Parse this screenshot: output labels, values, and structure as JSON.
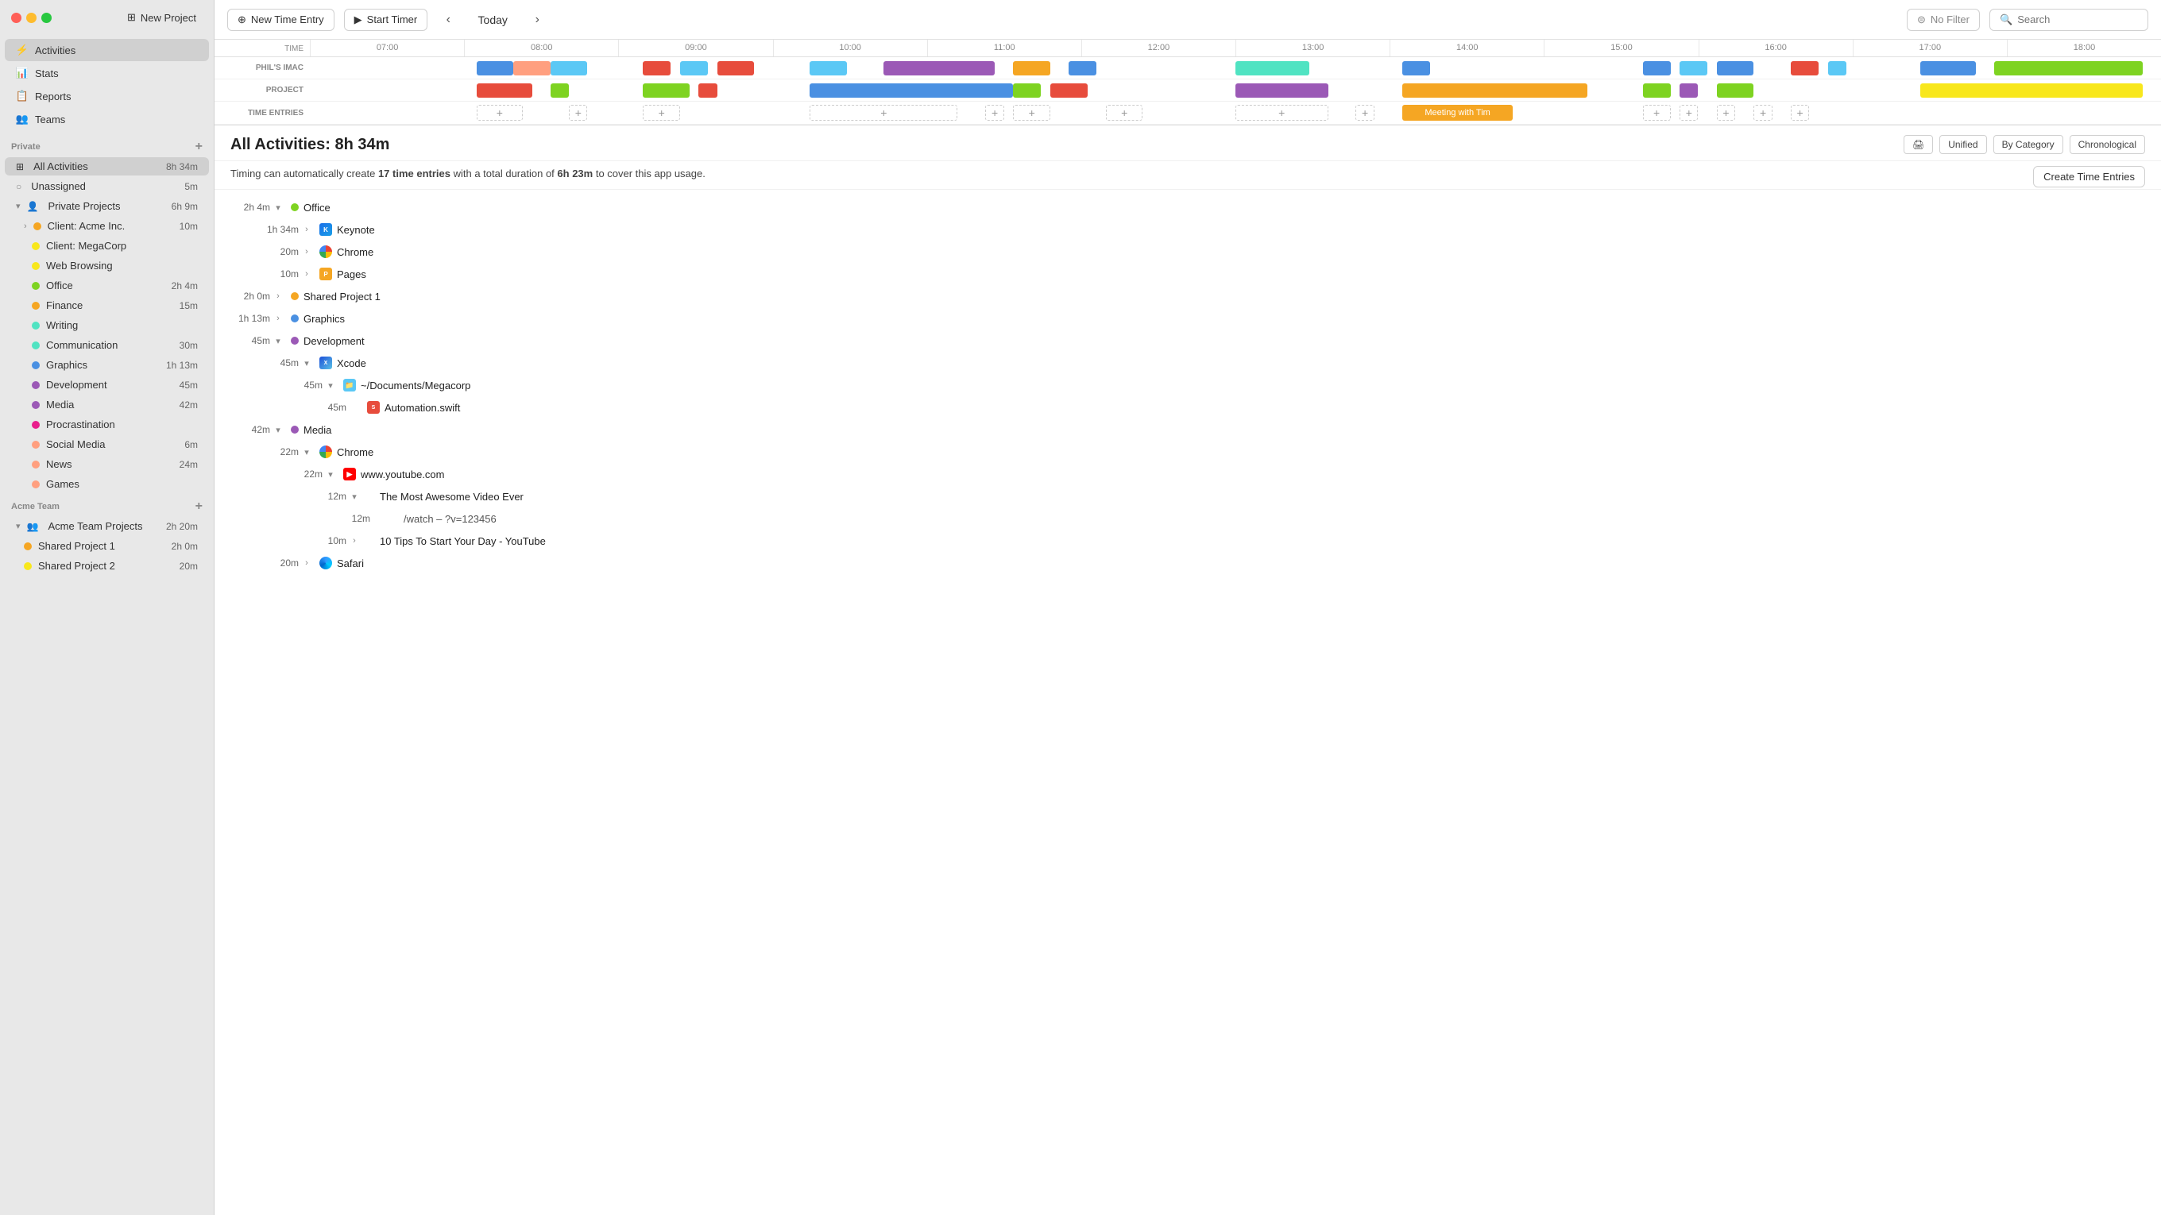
{
  "sidebar": {
    "new_project_label": "New Project",
    "nav": [
      {
        "id": "activities",
        "label": "Activities",
        "icon": "⚡",
        "active": true
      },
      {
        "id": "stats",
        "label": "Stats",
        "icon": "📊"
      },
      {
        "id": "reports",
        "label": "Reports",
        "icon": "📋"
      },
      {
        "id": "teams",
        "label": "Teams",
        "icon": "👥"
      }
    ],
    "private_section": "Private",
    "all_activities": {
      "label": "All Activities",
      "duration": "8h 34m"
    },
    "unassigned": {
      "label": "Unassigned",
      "duration": "5m"
    },
    "private_projects": {
      "label": "Private Projects",
      "duration": "6h 9m"
    },
    "clients": [
      {
        "label": "Client: Acme Inc.",
        "duration": "10m",
        "color": "dot-orange"
      },
      {
        "label": "Client: MegaCorp",
        "duration": "",
        "color": "dot-yellow"
      },
      {
        "label": "Web Browsing",
        "duration": "",
        "color": "dot-yellow"
      },
      {
        "label": "Office",
        "duration": "2h 4m",
        "color": "dot-lime"
      },
      {
        "label": "Finance",
        "duration": "15m",
        "color": "dot-orange"
      },
      {
        "label": "Writing",
        "duration": "",
        "color": "dot-cyan"
      },
      {
        "label": "Communication",
        "duration": "30m",
        "color": "dot-cyan"
      },
      {
        "label": "Graphics",
        "duration": "1h 13m",
        "color": "dot-blue"
      },
      {
        "label": "Development",
        "duration": "45m",
        "color": "dot-purple"
      },
      {
        "label": "Media",
        "duration": "42m",
        "color": "dot-purple"
      },
      {
        "label": "Procrastination",
        "duration": "",
        "color": "dot-magenta"
      },
      {
        "label": "Social Media",
        "duration": "6m",
        "color": "dot-peach"
      },
      {
        "label": "News",
        "duration": "24m",
        "color": "dot-peach"
      },
      {
        "label": "Games",
        "duration": "",
        "color": "dot-peach"
      }
    ],
    "acme_team_section": "Acme Team",
    "acme_team_projects": {
      "label": "Acme Team Projects",
      "duration": "2h 20m"
    },
    "shared_projects": [
      {
        "label": "Shared Project 1",
        "duration": "2h 0m",
        "color": "dot-orange"
      },
      {
        "label": "Shared Project 2",
        "duration": "20m",
        "color": "dot-yellow"
      }
    ]
  },
  "toolbar": {
    "new_time_entry": "New Time Entry",
    "start_timer": "Start Timer",
    "today": "Today",
    "no_filter": "No Filter",
    "search_placeholder": "Search"
  },
  "timeline": {
    "hours": [
      "07:00",
      "08:00",
      "09:00",
      "10:00",
      "11:00",
      "12:00",
      "13:00",
      "14:00",
      "15:00",
      "16:00",
      "17:00",
      "18:00"
    ],
    "rows": [
      {
        "label": "PHIL'S IMAC"
      },
      {
        "label": "PROJECT"
      },
      {
        "label": "TIME ENTRIES"
      }
    ]
  },
  "activity": {
    "title": "All Activities: 8h 34m",
    "timing_note_prefix": "Timing can automatically create ",
    "time_entries_count": "17 time entries",
    "duration_note": " with a total duration of ",
    "total_duration": "6h 23m",
    "timing_note_suffix": " to cover this app usage.",
    "view_unified": "Unified",
    "view_by_category": "By Category",
    "view_chronological": "Chronological",
    "create_btn": "Create Time Entries",
    "print_icon": "🖨",
    "items": [
      {
        "indent": 0,
        "duration": "2h 4m",
        "chevron": "▾",
        "dot_color": "#7ed321",
        "icon": "",
        "name": "Office",
        "icon_type": "dot"
      },
      {
        "indent": 1,
        "duration": "1h 34m",
        "chevron": "›",
        "dot_color": "",
        "icon": "keynote",
        "name": "Keynote",
        "icon_type": "app"
      },
      {
        "indent": 1,
        "duration": "20m",
        "chevron": "›",
        "dot_color": "",
        "icon": "chrome",
        "name": "Chrome",
        "icon_type": "app"
      },
      {
        "indent": 1,
        "duration": "10m",
        "chevron": "›",
        "dot_color": "",
        "icon": "pages",
        "name": "Pages",
        "icon_type": "app"
      },
      {
        "indent": 0,
        "duration": "2h 0m",
        "chevron": "›",
        "dot_color": "#f5a623",
        "icon": "",
        "name": "Shared Project 1",
        "icon_type": "dot"
      },
      {
        "indent": 0,
        "duration": "1h 13m",
        "chevron": "›",
        "dot_color": "#4a90e2",
        "icon": "",
        "name": "Graphics",
        "icon_type": "dot"
      },
      {
        "indent": 0,
        "duration": "45m",
        "chevron": "▾",
        "dot_color": "#9b59b6",
        "icon": "",
        "name": "Development",
        "icon_type": "dot"
      },
      {
        "indent": 1,
        "duration": "45m",
        "chevron": "▾",
        "dot_color": "",
        "icon": "xcode",
        "name": "Xcode",
        "icon_type": "app"
      },
      {
        "indent": 2,
        "duration": "45m",
        "chevron": "▾",
        "dot_color": "",
        "icon": "folder",
        "name": "~/Documents/Megacorp",
        "icon_type": "app"
      },
      {
        "indent": 3,
        "duration": "45m",
        "chevron": "",
        "dot_color": "",
        "icon": "swift",
        "name": "Automation.swift",
        "icon_type": "app"
      },
      {
        "indent": 0,
        "duration": "42m",
        "chevron": "▾",
        "dot_color": "#9b59b6",
        "icon": "",
        "name": "Media",
        "icon_type": "dot"
      },
      {
        "indent": 1,
        "duration": "22m",
        "chevron": "▾",
        "dot_color": "",
        "icon": "chrome",
        "name": "Chrome",
        "icon_type": "app"
      },
      {
        "indent": 2,
        "duration": "22m",
        "chevron": "▾",
        "dot_color": "",
        "icon": "youtube",
        "name": "www.youtube.com",
        "icon_type": "app"
      },
      {
        "indent": 3,
        "duration": "12m",
        "chevron": "▾",
        "dot_color": "",
        "icon": "",
        "name": "The Most Awesome Video Ever",
        "icon_type": "none"
      },
      {
        "indent": 4,
        "duration": "12m",
        "chevron": "",
        "dot_color": "",
        "icon": "",
        "name": "/watch – ?v=123456",
        "icon_type": "none"
      },
      {
        "indent": 3,
        "duration": "10m",
        "chevron": "›",
        "dot_color": "",
        "icon": "",
        "name": "10 Tips To Start Your Day - YouTube",
        "icon_type": "none"
      },
      {
        "indent": 1,
        "duration": "20m",
        "chevron": "›",
        "dot_color": "",
        "icon": "safari",
        "name": "Safari",
        "icon_type": "app"
      }
    ]
  }
}
